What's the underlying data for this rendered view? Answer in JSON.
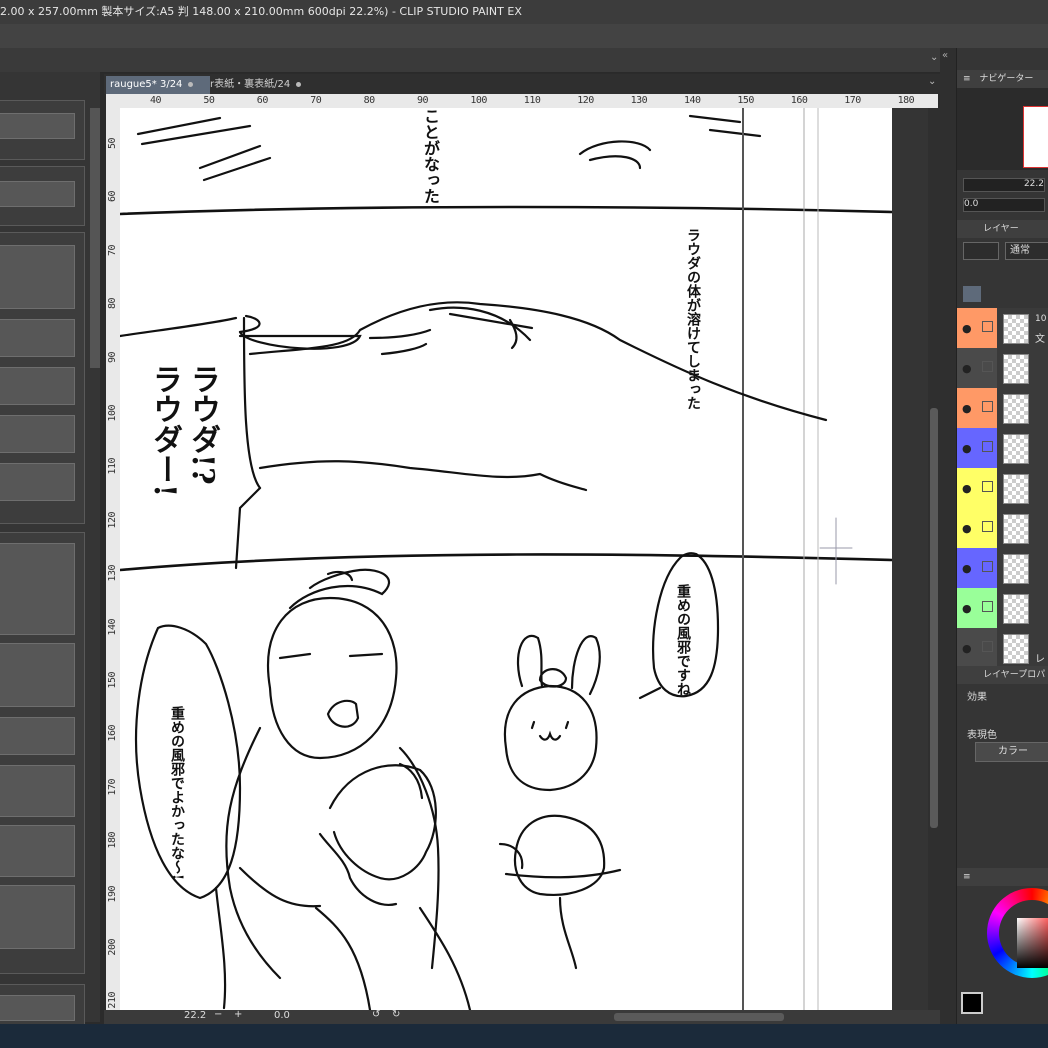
{
  "window": {
    "title": "2.00 x 257.00mm 製本サイズ:A5 判 148.00 x 210.00mm 600dpi 22.2%)  - CLIP STUDIO PAINT EX"
  },
  "tabs": [
    {
      "label": "raugue5*  3/24",
      "active": true
    },
    {
      "label": "r表紙・裏表紙/24",
      "active": false
    }
  ],
  "ruler": {
    "top_ticks": [
      "40",
      "50",
      "60",
      "70",
      "80",
      "90",
      "100",
      "110",
      "120",
      "130",
      "140",
      "150",
      "160",
      "170",
      "180"
    ],
    "left_ticks": [
      "50",
      "60",
      "70",
      "80",
      "90",
      "100",
      "110",
      "120",
      "130",
      "140",
      "150",
      "160",
      "170",
      "180",
      "190",
      "200",
      "210"
    ]
  },
  "canvas_text": {
    "bubble_top": "ことがなった",
    "bubble_body": "ラウダの体が溶けてしまった",
    "shout_1": "ラウダ!?",
    "shout_2": "ラウダー!",
    "bubble_cold": "重めの風邪ですね",
    "bubble_relief": "重めの風邪でよかったな〜!"
  },
  "statusbar": {
    "zoom": "22.2",
    "angle": "0.0"
  },
  "navigator": {
    "title": "ナビゲーター",
    "zoom": "22.2",
    "angle": "0.0"
  },
  "layer_panel": {
    "title": "レイヤー",
    "blend_mode": "通常",
    "rows": [
      {
        "name": "10",
        "sub": "文",
        "color": "#ff9966"
      },
      {
        "name": "",
        "sub": "",
        "color": "#4a4a4a"
      },
      {
        "name": "",
        "sub": "",
        "color": "#ff9966"
      },
      {
        "name": "",
        "sub": "",
        "color": "#6666ff"
      },
      {
        "name": "",
        "sub": "",
        "color": "#ffff66"
      },
      {
        "name": "",
        "sub": "",
        "color": "#ffff66"
      },
      {
        "name": "",
        "sub": "",
        "color": "#6666ff"
      },
      {
        "name": "",
        "sub": "",
        "color": "#99ff99"
      },
      {
        "name": "",
        "sub": "レ",
        "color": "#4a4a4a"
      }
    ]
  },
  "layer_property": {
    "title": "レイヤープロパ",
    "effect_label": "効果",
    "expression_label": "表現色",
    "color_button": "カラー"
  },
  "colors": {
    "accent": "#5e6a7a",
    "main_color": "#000000"
  }
}
